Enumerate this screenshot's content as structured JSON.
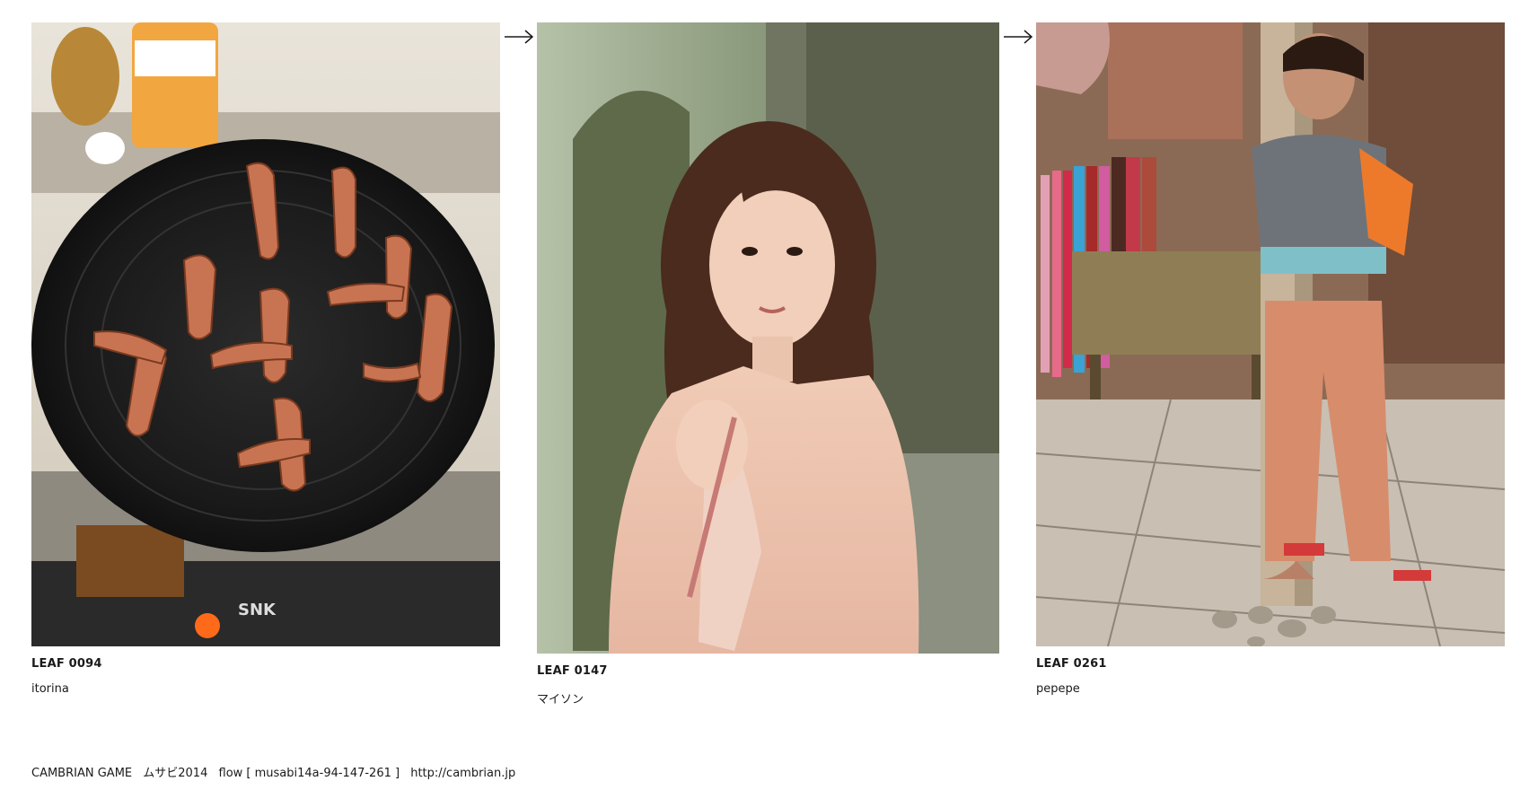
{
  "leaves": [
    {
      "id_label": "LEAF 0094",
      "author": "itorina",
      "photo_subject": "octopus sausages in frying pan"
    },
    {
      "id_label": "LEAF 0147",
      "author": "マイソン",
      "photo_subject": "woman in pink blouse against stone wall"
    },
    {
      "id_label": "LEAF 0261",
      "author": "pepepe",
      "photo_subject": "child holding wooden pole at market"
    }
  ],
  "footer": {
    "site_name": "CAMBRIAN GAME",
    "project": "ムサビ2014",
    "flow_label": "flow [ musabi14a-94-147-261 ]",
    "url": "http://cambrian.jp"
  },
  "icons": {
    "flow_arrow": "right-arrow-icon"
  },
  "colors": {
    "text": "#1a1a1a",
    "background": "#ffffff"
  }
}
